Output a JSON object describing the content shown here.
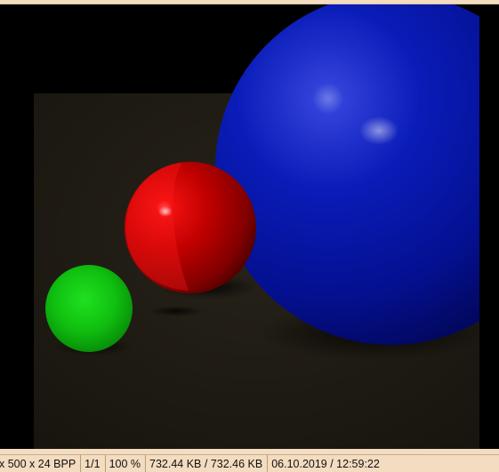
{
  "statusbar": {
    "dimensions": "x 500 x 24 BPP",
    "page": "1/1",
    "zoom": "100 %",
    "filesize": "732.44 KB / 732.46 KB",
    "datetime": "06.10.2019 / 12:59:22"
  },
  "colors": {
    "frame": "#f3dcc0",
    "sphere_red": "#d80000",
    "sphere_green": "#10c010",
    "sphere_blue": "#0010b0",
    "floor": "#1c1912"
  }
}
